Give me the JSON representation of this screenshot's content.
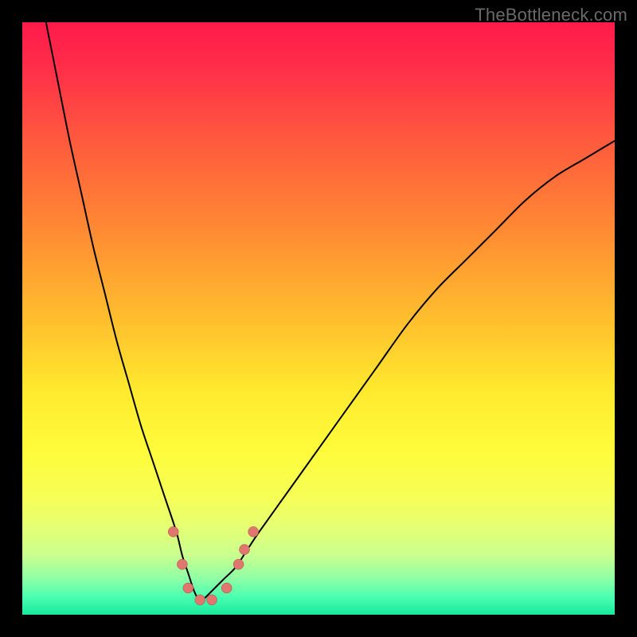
{
  "watermark": "TheBottleneck.com",
  "colors": {
    "marker_fill": "#e0766d",
    "marker_stroke": "#a05048",
    "curve": "#000000",
    "gradient_top": "#ff1a4a",
    "gradient_bottom": "#18e89b"
  },
  "chart_data": {
    "type": "line",
    "title": "",
    "xlabel": "",
    "ylabel": "",
    "xlim": [
      0,
      100
    ],
    "ylim": [
      0,
      100
    ],
    "x_min_point": 30,
    "left_curve": {
      "x": [
        4,
        6,
        8,
        10,
        12,
        14,
        16,
        18,
        20,
        22,
        24,
        26,
        27,
        28,
        29,
        30
      ],
      "y": [
        100,
        90,
        80,
        71,
        62,
        54,
        46,
        39,
        32,
        26,
        20,
        14,
        10,
        7,
        4,
        2
      ]
    },
    "right_curve": {
      "x": [
        30,
        32,
        34,
        36,
        38,
        40,
        45,
        50,
        55,
        60,
        65,
        70,
        75,
        80,
        85,
        90,
        95,
        100
      ],
      "y": [
        2,
        4,
        6,
        8,
        11,
        14,
        21,
        28,
        35,
        42,
        49,
        55,
        60,
        65,
        70,
        74,
        77,
        80
      ]
    },
    "markers": [
      {
        "x": 25.5,
        "y": 14
      },
      {
        "x": 27.0,
        "y": 8.5
      },
      {
        "x": 28.0,
        "y": 4.5
      },
      {
        "x": 30.0,
        "y": 2.5
      },
      {
        "x": 32.0,
        "y": 2.5
      },
      {
        "x": 34.5,
        "y": 4.5
      },
      {
        "x": 36.5,
        "y": 8.5
      },
      {
        "x": 37.5,
        "y": 11
      },
      {
        "x": 39.0,
        "y": 14
      }
    ]
  }
}
